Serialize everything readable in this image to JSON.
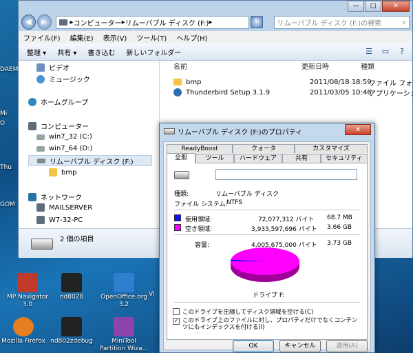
{
  "desktop": {
    "left_fragments": [
      "DAEM",
      "Mi",
      "O",
      "Thu",
      "GOM"
    ],
    "icons": [
      {
        "label": "MP Navigator 3.0",
        "color": "#c0392b"
      },
      {
        "label": "nd8028",
        "color": "#222222"
      },
      {
        "label": "OpenOffice.org 3.2",
        "color": "#2f7fd1"
      },
      {
        "label": "Mozilla Firefox",
        "color": "#e67e22"
      },
      {
        "label": "nd802zdebug",
        "color": "#222222"
      },
      {
        "label": "MiniTool Partition Wiza...",
        "color": "#8e44ad"
      }
    ],
    "edge_label": "Vi"
  },
  "explorer": {
    "address": {
      "segments": [
        "コンピューター",
        "リムーバブル ディスク (F:)"
      ]
    },
    "search_placeholder": "リムーバブル ディスク (F:)の検索",
    "menu": [
      "ファイル(F)",
      "編集(E)",
      "表示(V)",
      "ツール(T)",
      "ヘルプ(H)"
    ],
    "toolbar": [
      "整理 ▾",
      "共有 ▾",
      "書き込む",
      "新しいフォルダー"
    ],
    "nav": [
      {
        "label": "ビデオ",
        "color": "#6d8fc4"
      },
      {
        "label": "ミュージック",
        "color": "#4a90d9"
      },
      {
        "label": "ホームグループ",
        "color": "#2e86c1"
      },
      {
        "label": "コンピューター",
        "color": "#5d6d7e"
      },
      {
        "label": "win7_32 (C:)",
        "color": "#95a5a6"
      },
      {
        "label": "win7_64 (D:)",
        "color": "#95a5a6"
      },
      {
        "label": "リムーバブル ディスク (F:)",
        "color": "#7f8c8d"
      },
      {
        "label": "bmp",
        "color": "#f4c542"
      },
      {
        "label": "ネットワーク",
        "color": "#2874a6"
      },
      {
        "label": "MAILSERVER",
        "color": "#5d6d7e"
      },
      {
        "label": "W7-32-PC",
        "color": "#5d6d7e"
      }
    ],
    "columns": [
      "名前",
      "更新日時",
      "種類"
    ],
    "files": [
      {
        "name": "bmp",
        "date": "2011/08/18 18:59",
        "type": "ファイル フォル",
        "color": "#f4c542"
      },
      {
        "name": "Thunderbird Setup 3.1.9",
        "date": "2011/03/05 10:46",
        "type": "アプリケーショ",
        "color": "#2e6db4"
      }
    ],
    "status": "2 個の項目"
  },
  "dialog": {
    "title": "リムーバブル ディスク (F:)のプロパティ",
    "close_label": "✕",
    "tabs_row1": [
      "ReadyBoost",
      "クォータ",
      "カスタマイズ"
    ],
    "tabs_row2": [
      "全般",
      "ツール",
      "ハードウェア",
      "共有",
      "セキュリティ"
    ],
    "volume_name": "",
    "type_label": "種類:",
    "type_value": "リムーバブル ディスク",
    "fs_label": "ファイル システム:",
    "fs_value": "NTFS",
    "used": {
      "label": "使用領域:",
      "bytes": "72,077,312 バイト",
      "human": "68.7 MB",
      "color": "#1010ff"
    },
    "free": {
      "label": "空き領域:",
      "bytes": "3,933,597,696 バイト",
      "human": "3.66 GB",
      "color": "#ff00ff"
    },
    "capacity": {
      "label": "容量:",
      "bytes": "4,005,675,000 バイト",
      "human": "3.73 GB"
    },
    "used_fraction": 0.018,
    "drive_label": "ドライブ F:",
    "check_compress": "このドライブを圧縮してディスク領域を空ける(C)",
    "check_index": "このドライブ上のファイルに対し、プロパティだけでなくコンテンツにもインデックスを付ける(I)",
    "buttons": {
      "ok": "OK",
      "cancel": "キャンセル",
      "apply": "適用(A)"
    }
  }
}
